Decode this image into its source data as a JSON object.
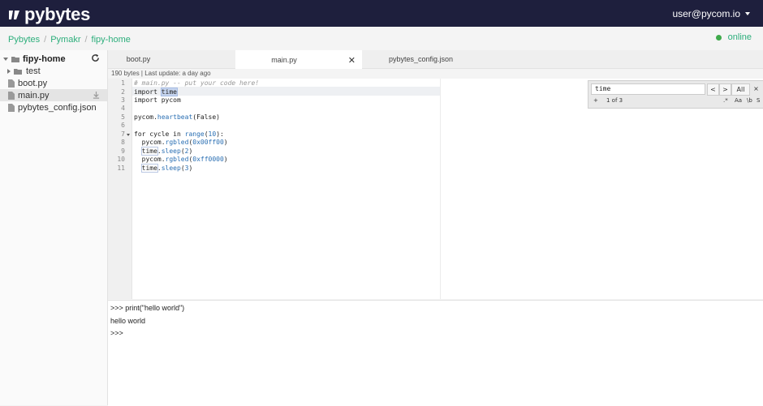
{
  "app": {
    "brand": "pybytes",
    "user": "user@pycom.io",
    "accent": "#2cae7b",
    "header_bg": "#1e1f3d"
  },
  "breadcrumb": [
    "Pybytes",
    "Pymakr",
    "fipy-home"
  ],
  "device_status": {
    "label": "online",
    "color": "#3faa4b"
  },
  "sidebar": {
    "root": "fipy-home",
    "items": [
      {
        "label": "test",
        "type": "folder"
      },
      {
        "label": "boot.py",
        "type": "file"
      },
      {
        "label": "main.py",
        "type": "file",
        "selected": true
      },
      {
        "label": "pybytes_config.json",
        "type": "file"
      }
    ]
  },
  "tabs": [
    {
      "label": "boot.py"
    },
    {
      "label": "main.py",
      "active": true
    },
    {
      "label": "pybytes_config.json"
    }
  ],
  "file_info": "190 bytes | Last update: a day ago",
  "editor": {
    "line_numbers": [
      "1",
      "2",
      "3",
      "4",
      "5",
      "6",
      "7",
      "8",
      "9",
      "10",
      "11"
    ],
    "code": {
      "l1": "# main.py -- put your code here!",
      "l2a": "import ",
      "l2b": "time",
      "l3": "import pycom",
      "l5a": "pycom.",
      "l5b": "heartbeat",
      "l5c": "(False)",
      "l7a": "for cycle in ",
      "l7b": "range",
      "l7c": "(",
      "l7d": "10",
      "l7e": "):",
      "l8a": "  pycom.",
      "l8b": "rgbled",
      "l8c": "(",
      "l8d": "0x00ff00",
      "l8e": ")",
      "l9a": "  ",
      "l9b": "time",
      "l9c": ".",
      "l9d": "sleep",
      "l9e": "(",
      "l9f": "2",
      "l9g": ")",
      "l10a": "  pycom.",
      "l10b": "rgbled",
      "l10c": "(",
      "l10d": "0xff0000",
      "l10e": ")",
      "l11a": "  ",
      "l11b": "time",
      "l11c": ".",
      "l11d": "sleep",
      "l11e": "(",
      "l11f": "3",
      "l11g": ")"
    }
  },
  "search": {
    "value": "time",
    "prev": "<",
    "next": ">",
    "all": "All",
    "close": "×",
    "add": "+",
    "count": "1 of 3",
    "regex": ".*",
    "case": "Aa",
    "word": "\\b",
    "selection": "S"
  },
  "console": {
    "lines": [
      ">>> print(\"hello world\")",
      "hello world",
      ">>>"
    ]
  }
}
